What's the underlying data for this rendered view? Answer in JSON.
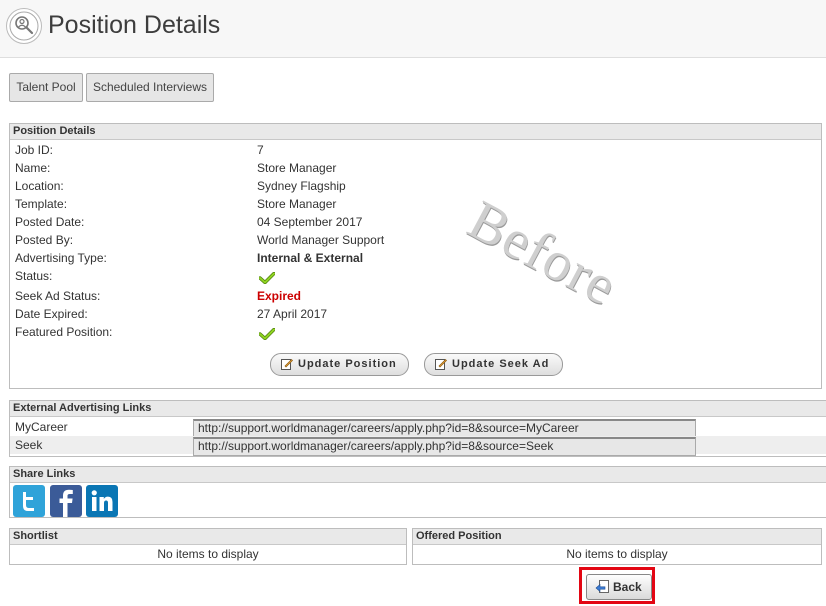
{
  "header": {
    "title": "Position Details"
  },
  "tabs": [
    {
      "label": "Talent Pool"
    },
    {
      "label": "Scheduled Interviews"
    }
  ],
  "details": {
    "heading": "Position Details",
    "fields": [
      {
        "label": "Job ID:",
        "value": "7"
      },
      {
        "label": "Name:",
        "value": "Store Manager"
      },
      {
        "label": "Location:",
        "value": "Sydney Flagship"
      },
      {
        "label": "Template:",
        "value": "Store Manager"
      },
      {
        "label": "Posted Date:",
        "value": "04 September 2017"
      },
      {
        "label": "Posted By:",
        "value": "World Manager Support"
      },
      {
        "label": "Advertising Type:",
        "value": "Internal & External"
      },
      {
        "label": "Status:",
        "value": ""
      },
      {
        "label": "Seek Ad Status:",
        "value": "Expired"
      },
      {
        "label": "Date Expired:",
        "value": "27 April 2017"
      },
      {
        "label": "Featured Position:",
        "value": ""
      }
    ],
    "status_icon": "check-icon",
    "featured_icon": "check-icon",
    "update_position_label": "Update Position",
    "update_seek_label": "Update Seek Ad",
    "watermark": "Before"
  },
  "external_links": {
    "heading": "External Advertising Links",
    "rows": [
      {
        "label": "MyCareer",
        "url": "http://support.worldmanager/careers/apply.php?id=8&source=MyCareer"
      },
      {
        "label": "Seek",
        "url": "http://support.worldmanager/careers/apply.php?id=8&source=Seek"
      }
    ]
  },
  "share": {
    "heading": "Share Links",
    "icons": [
      "twitter-icon",
      "facebook-icon",
      "linkedin-icon"
    ]
  },
  "shortlist": {
    "heading": "Shortlist",
    "empty": "No items to display"
  },
  "offered": {
    "heading": "Offered Position",
    "empty": "No items to display"
  },
  "back_label": "Back",
  "colors": {
    "expired": "#cc0000",
    "check": "#7cc21a",
    "highlight": "#e30613",
    "twitter": "#2fa3d9",
    "facebook": "#3b5b98",
    "linkedin": "#0a76b4"
  }
}
